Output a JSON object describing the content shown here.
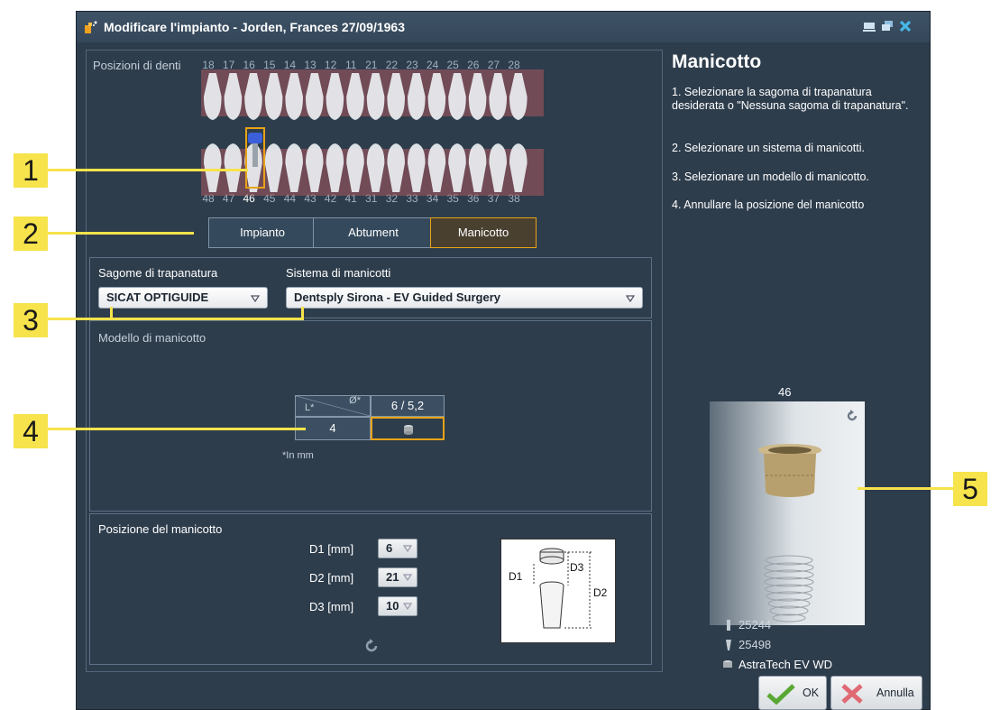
{
  "window": {
    "title": "Modificare l'impianto - Jorden, Frances 27/09/1963"
  },
  "teeth": {
    "label": "Posizioni di denti",
    "upper": [
      "18",
      "17",
      "16",
      "15",
      "14",
      "13",
      "12",
      "11",
      "21",
      "22",
      "23",
      "24",
      "25",
      "26",
      "27",
      "28"
    ],
    "lower": [
      "48",
      "47",
      "46",
      "45",
      "44",
      "43",
      "42",
      "41",
      "31",
      "32",
      "33",
      "34",
      "35",
      "36",
      "37",
      "38"
    ],
    "selected": "46"
  },
  "steps": {
    "implant": "Impianto",
    "abutment": "Abtument",
    "sleeve": "Manicotto"
  },
  "drill_template": {
    "label": "Sagome di trapanatura",
    "value": "SICAT OPTIGUIDE"
  },
  "sleeve_system": {
    "label": "Sistema di manicotti",
    "value": "Dentsply Sirona - EV Guided Surgery"
  },
  "sleeve_model": {
    "label": "Modello di manicotto",
    "header_l": "L*",
    "header_d": "Ø*",
    "column": "6 / 5,2",
    "row": "4",
    "note": "*In mm"
  },
  "sleeve_position": {
    "label": "Posizione del manicotto",
    "d1_label": "D1 [mm]",
    "d1_value": "6",
    "d2_label": "D2 [mm]",
    "d2_value": "21",
    "d3_label": "D3 [mm]",
    "d3_value": "10",
    "diagram": {
      "d1": "D1",
      "d2": "D2",
      "d3": "D3"
    }
  },
  "help": {
    "title": "Manicotto",
    "step1": "1. Selezionare la sagoma di trapanatura desiderata o \"Nessuna sagoma di trapanatura\".",
    "step2": "2. Selezionare un sistema di manicotti.",
    "step3": "3. Selezionare un modello di manicotto.",
    "step4": "4. Annullare la posizione del manicotto"
  },
  "preview": {
    "tooth": "46",
    "implant_code": "25244",
    "abutment_code": "25498",
    "sleeve_name": "AstraTech EV WD"
  },
  "buttons": {
    "ok": "OK",
    "cancel": "Annulla"
  },
  "callouts": [
    "1",
    "2",
    "3",
    "4",
    "5"
  ],
  "colors": {
    "window_bg": "#2e3d4c",
    "titlebar": "#3a4d60",
    "accent": "#e8a317",
    "callout": "#f7e34b"
  }
}
